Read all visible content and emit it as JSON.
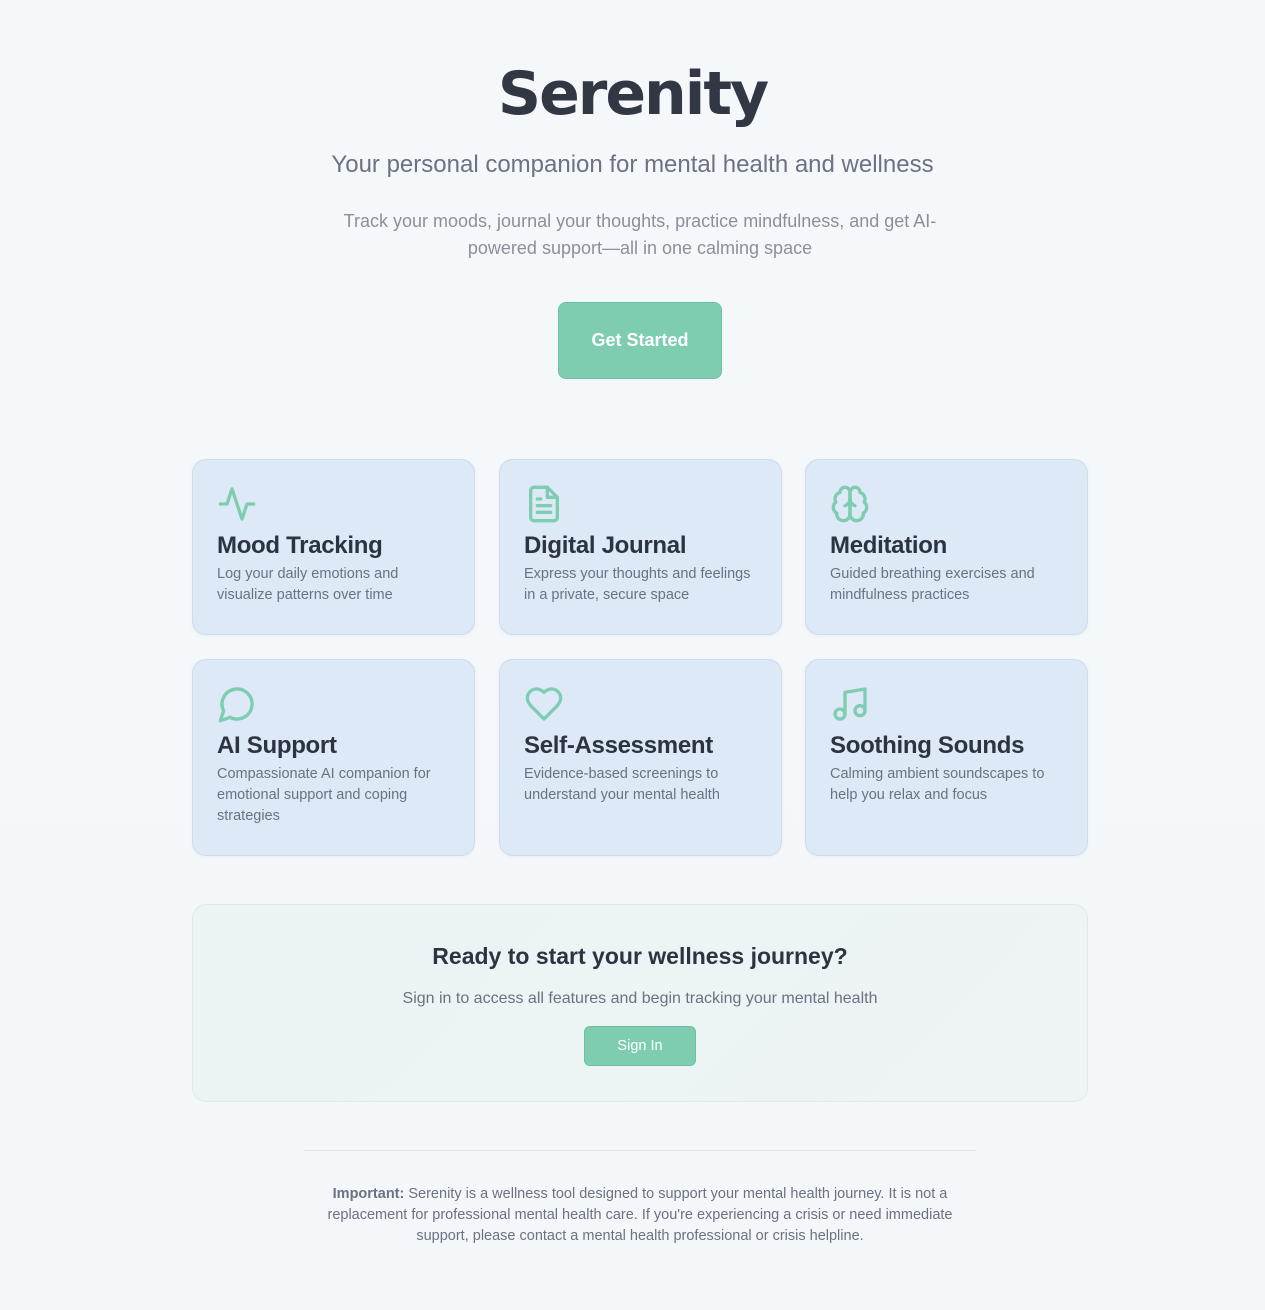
{
  "hero": {
    "title": "Serenity",
    "tagline": "Your personal companion for mental health and wellness",
    "intro": "Track your moods, journal your thoughts, practice mindfulness, and get AI-powered support—all in one calming space",
    "cta_label": "Get Started"
  },
  "colors": {
    "accent": "#7ecdb1",
    "card_bg": "#dde9f6",
    "text_dark": "#323843",
    "text_muted": "#6b7280"
  },
  "features": [
    {
      "icon": "activity-pulse-icon",
      "title": "Mood Tracking",
      "description": "Log your daily emotions and visualize patterns over time"
    },
    {
      "icon": "document-icon",
      "title": "Digital Journal",
      "description": "Express your thoughts and feelings in a private, secure space"
    },
    {
      "icon": "brain-icon",
      "title": "Meditation",
      "description": "Guided breathing exercises and mindfulness practices"
    },
    {
      "icon": "chat-bubble-icon",
      "title": "AI Support",
      "description": "Compassionate AI companion for emotional support and coping strategies"
    },
    {
      "icon": "heart-icon",
      "title": "Self-Assessment",
      "description": "Evidence-based screenings to understand your mental health"
    },
    {
      "icon": "music-note-icon",
      "title": "Soothing Sounds",
      "description": "Calming ambient soundscapes to help you relax and focus"
    }
  ],
  "signin": {
    "title": "Ready to start your wellness journey?",
    "text": "Sign in to access all features and begin tracking your mental health",
    "button_label": "Sign In"
  },
  "disclaimer": {
    "label": "Important:",
    "text": " Serenity is a wellness tool designed to support your mental health journey. It is not a replacement for professional mental health care. If you're experiencing a crisis or need immediate support, please contact a mental health professional or crisis helpline."
  }
}
